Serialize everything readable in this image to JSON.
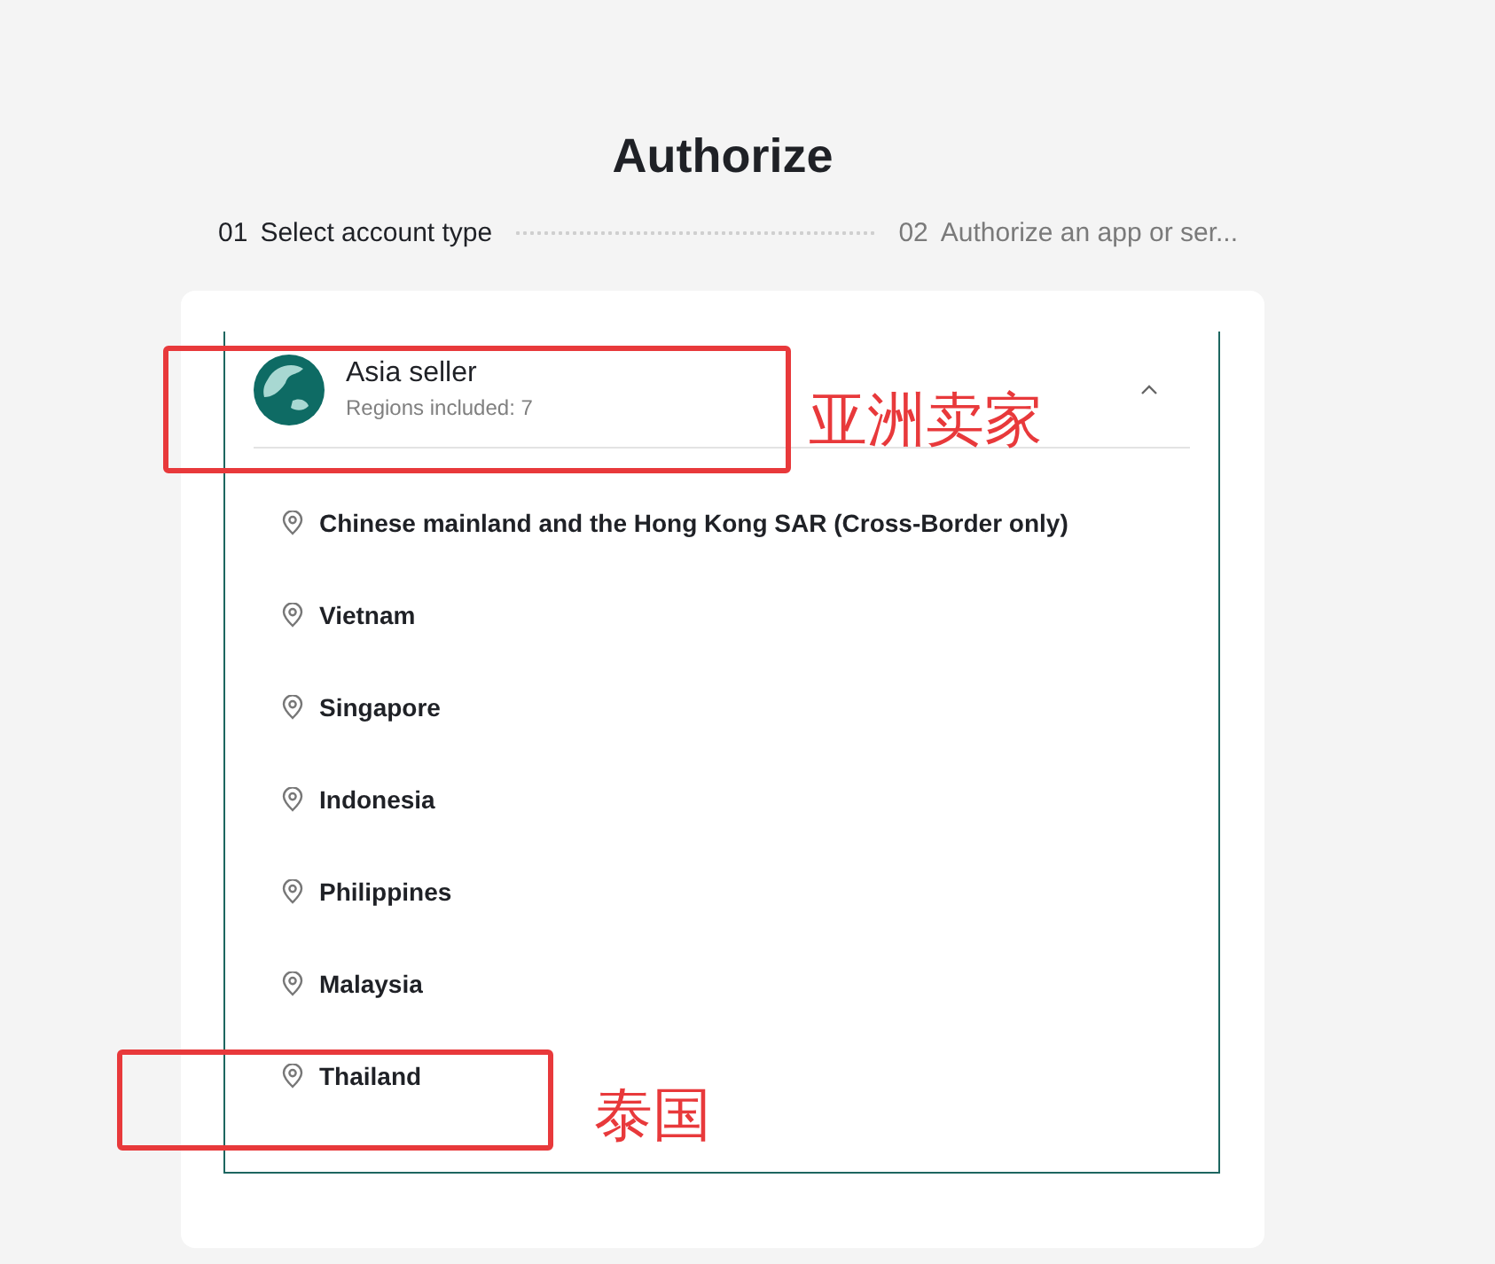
{
  "title": "Authorize",
  "steps": [
    {
      "number": "01",
      "label": "Select account type",
      "selected": true
    },
    {
      "number": "02",
      "label": "Authorize an app or ser...",
      "selected": false
    }
  ],
  "account": {
    "name": "Asia seller",
    "subtitle": "Regions included: 7",
    "expanded": true,
    "regions": [
      "Chinese mainland and the Hong Kong SAR (Cross-Border only)",
      "Vietnam",
      "Singapore",
      "Indonesia",
      "Philippines",
      "Malaysia",
      "Thailand"
    ]
  },
  "annotations": [
    {
      "label": "亚洲卖家"
    },
    {
      "label": "泰国"
    }
  ]
}
